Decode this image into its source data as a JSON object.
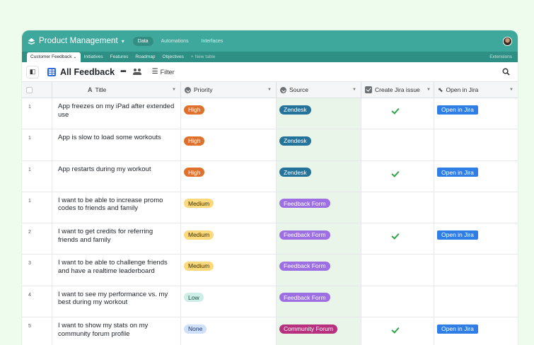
{
  "app": {
    "title": "Product Management",
    "nav": [
      "Data",
      "Automations",
      "Interfaces"
    ]
  },
  "tabs": {
    "active": "Customer Feedback",
    "others": [
      "Initiatives",
      "Features",
      "Roadmap",
      "Objectives"
    ],
    "add_label": "+ New table",
    "extensions": "Extensions"
  },
  "view": {
    "title": "All Feedback",
    "more": "•••",
    "filter_label": "Filter"
  },
  "columns": {
    "title": "Title",
    "priority": "Priority",
    "source": "Source",
    "create_jira": "Create Jira issue",
    "open_jira": "Open in Jira"
  },
  "colors": {
    "High": {
      "bg": "#e0712c",
      "fg": "#ffffff"
    },
    "Medium": {
      "bg": "#fbd97c",
      "fg": "#3a3000"
    },
    "Low": {
      "bg": "#cdeee6",
      "fg": "#1b4a40"
    },
    "None": {
      "bg": "#cfe0fb",
      "fg": "#1c3766"
    },
    "Zendesk": {
      "bg": "#23739a",
      "fg": "#ffffff"
    },
    "Feedback Form": {
      "bg": "#9c6fe3",
      "fg": "#ffffff"
    },
    "Community Forum": {
      "bg": "#b8317f",
      "fg": "#ffffff"
    },
    "jira_link": {
      "bg": "#2f7ee6",
      "fg": "#ffffff"
    }
  },
  "rows": [
    {
      "num": "1",
      "title": "App freezes on my iPad after extended use",
      "priority": "High",
      "source": "Zendesk",
      "jira_created": true,
      "open_label": "Open in Jira"
    },
    {
      "num": "1",
      "title": "App is slow to load some workouts",
      "priority": "High",
      "source": "Zendesk",
      "jira_created": false,
      "open_label": ""
    },
    {
      "num": "1",
      "title": "App restarts during my workout",
      "priority": "High",
      "source": "Zendesk",
      "jira_created": true,
      "open_label": "Open in Jira"
    },
    {
      "num": "1",
      "title": "I want to be able to increase promo codes to friends and family",
      "priority": "Medium",
      "source": "Feedback Form",
      "jira_created": false,
      "open_label": ""
    },
    {
      "num": "2",
      "title": "I want to get credits for referring friends and family",
      "priority": "Medium",
      "source": "Feedback Form",
      "jira_created": true,
      "open_label": "Open in Jira"
    },
    {
      "num": "3",
      "title": "I want to be able to challenge friends and have a realtime leaderboard",
      "priority": "Medium",
      "source": "Feedback Form",
      "jira_created": false,
      "open_label": ""
    },
    {
      "num": "4",
      "title": "I want to see my performance vs. my best during my workout",
      "priority": "Low",
      "source": "Feedback Form",
      "jira_created": false,
      "open_label": ""
    },
    {
      "num": "5",
      "title": "I want to show my stats on my community forum profile",
      "priority": "None",
      "source": "Community Forum",
      "jira_created": true,
      "open_label": "Open in Jira"
    }
  ]
}
